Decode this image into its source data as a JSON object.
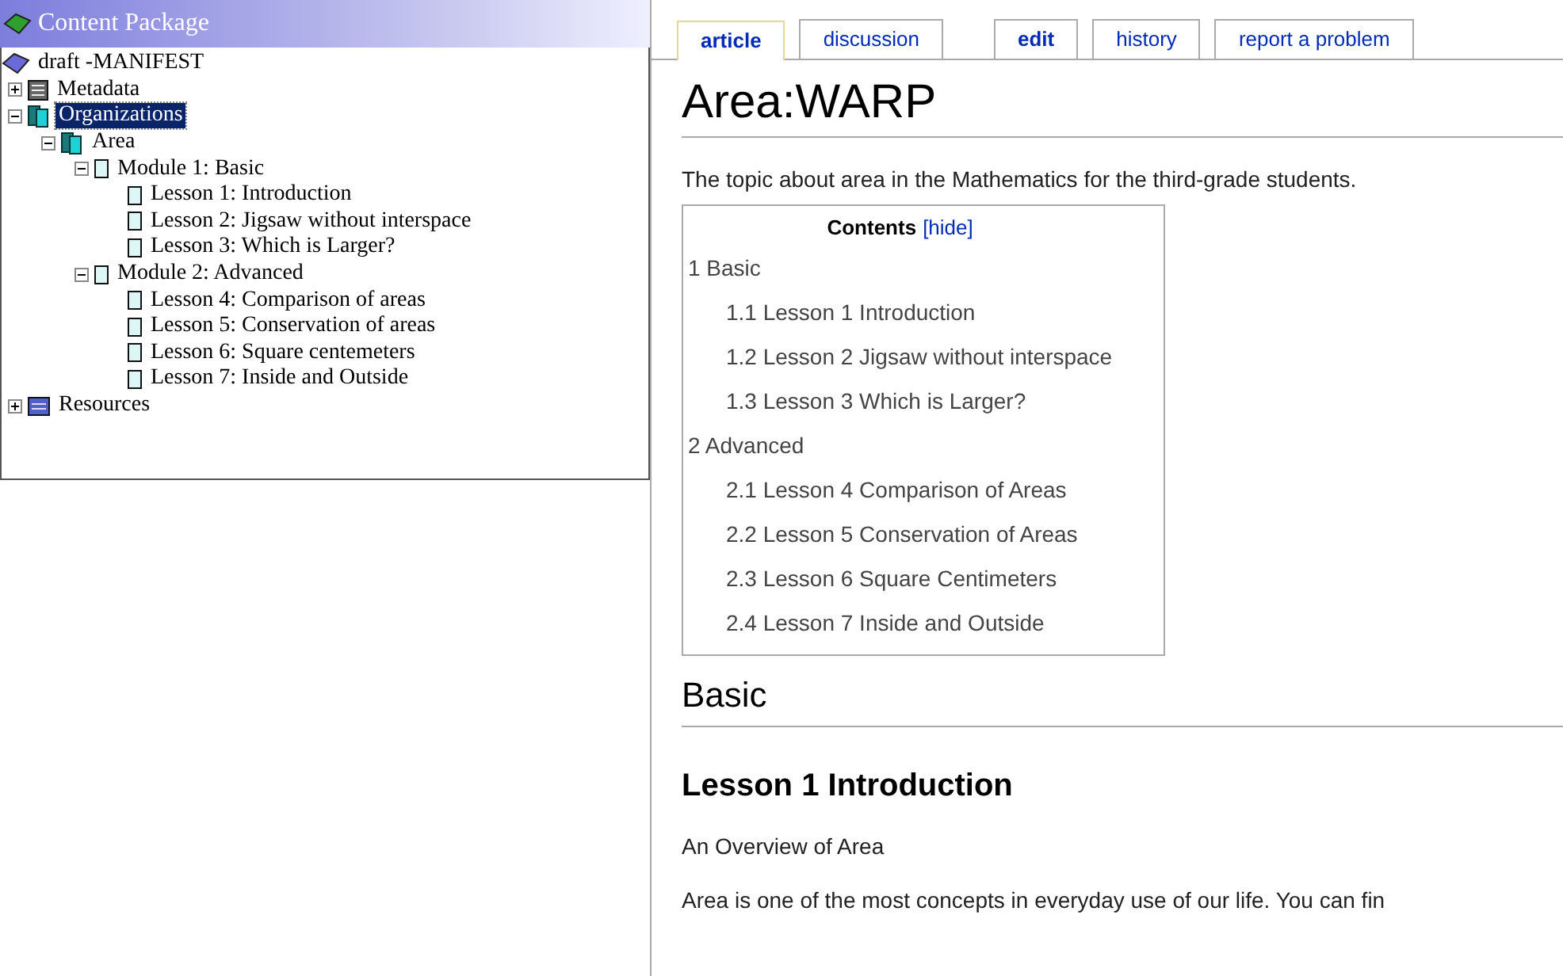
{
  "panel": {
    "title": "Content Package"
  },
  "tree": [
    {
      "label": "draft -MANIFEST",
      "kind": "manifest",
      "selected": false,
      "children": [
        {
          "label": "Metadata",
          "kind": "metadata",
          "selected": false,
          "expanded": false
        },
        {
          "label": "Organizations",
          "kind": "organizations",
          "selected": true,
          "expanded": true,
          "children": [
            {
              "label": "Area",
              "kind": "organization",
              "selected": false,
              "expanded": true,
              "children": [
                {
                  "label": "Module 1: Basic",
                  "kind": "item",
                  "selected": false,
                  "expanded": true,
                  "children": [
                    {
                      "label": "Lesson 1: Introduction",
                      "kind": "item",
                      "selected": false
                    },
                    {
                      "label": "Lesson 2: Jigsaw without interspace",
                      "kind": "item",
                      "selected": false
                    },
                    {
                      "label": "Lesson 3: Which is Larger?",
                      "kind": "item",
                      "selected": false
                    }
                  ]
                },
                {
                  "label": "Module 2: Advanced",
                  "kind": "item",
                  "selected": false,
                  "expanded": true,
                  "children": [
                    {
                      "label": "Lesson 4: Comparison of areas",
                      "kind": "item",
                      "selected": false
                    },
                    {
                      "label": "Lesson 5: Conservation of areas",
                      "kind": "item",
                      "selected": false
                    },
                    {
                      "label": "Lesson 6: Square centemeters",
                      "kind": "item",
                      "selected": false
                    },
                    {
                      "label": "Lesson 7: Inside and Outside",
                      "kind": "item",
                      "selected": false
                    }
                  ]
                }
              ]
            }
          ]
        },
        {
          "label": "Resources",
          "kind": "resources",
          "selected": false,
          "expanded": false
        }
      ]
    }
  ],
  "tabs": [
    {
      "label": "article",
      "selected": true,
      "bold": true
    },
    {
      "label": "discussion",
      "selected": false,
      "bold": false
    },
    {
      "label": "edit",
      "selected": false,
      "bold": true
    },
    {
      "label": "history",
      "selected": false,
      "bold": false
    },
    {
      "label": "report a problem",
      "selected": false,
      "bold": false
    }
  ],
  "article": {
    "title": "Area:WARP",
    "intro": "The topic about area in the Mathematics for the third-grade students.",
    "toc": {
      "title": "Contents",
      "toggle": "[hide]",
      "items": [
        {
          "label": "1 Basic",
          "children": [
            {
              "label": "1.1 Lesson 1 Introduction"
            },
            {
              "label": "1.2 Lesson 2 Jigsaw without interspace"
            },
            {
              "label": "1.3 Lesson 3 Which is Larger?"
            }
          ]
        },
        {
          "label": "2 Advanced",
          "children": [
            {
              "label": "2.1 Lesson 4 Comparison of Areas"
            },
            {
              "label": "2.2 Lesson 5 Conservation of Areas"
            },
            {
              "label": "2.3 Lesson 6 Square Centimeters"
            },
            {
              "label": "2.4 Lesson 7 Inside and Outside"
            }
          ]
        }
      ]
    },
    "section": "Basic",
    "subsection": "Lesson 1 Introduction",
    "subtitle": "An Overview of Area",
    "body": "Area is one of the most concepts in everyday use of our life. You can fin"
  }
}
